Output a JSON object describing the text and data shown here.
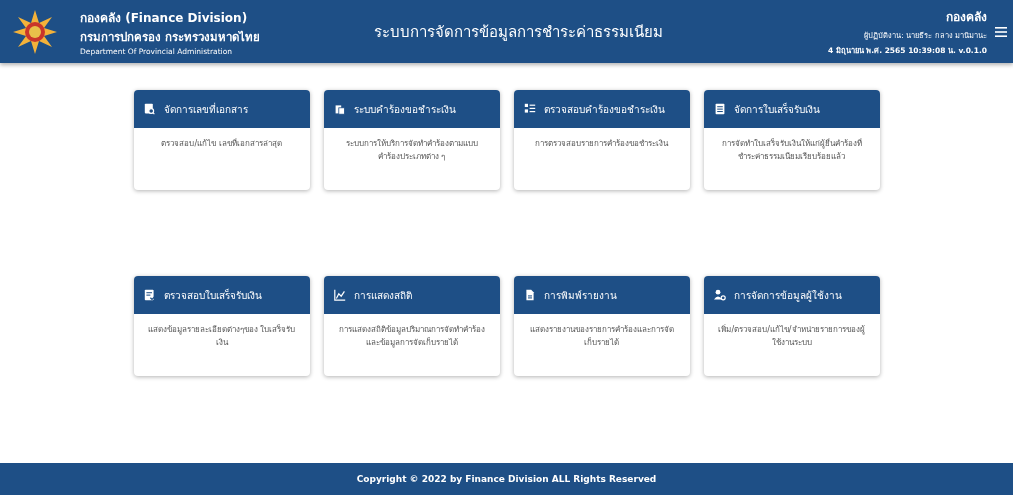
{
  "header": {
    "org_title": "กองคลัง (Finance Division)",
    "org_subtitle": "กรมการปกครอง กระทรวงมหาดไทย",
    "org_english": "Department Of Provincial Administration",
    "system_title": "ระบบการจัดการข้อมูลการชำระค่าธรรมเนียม",
    "unit": "กองคลัง",
    "user": "ผู้ปฏิบัติงาน: นายธีระ กลาง มานิมานะ",
    "datetime": "4 มิถุนายน พ.ศ. 2565 10:39:08 น. v.0.1.0"
  },
  "cards": [
    {
      "title": "จัดการเลขที่เอกสาร",
      "description": "ตรวจสอบ/แก้ไข เลขที่เอกสารล่าสุด"
    },
    {
      "title": "ระบบคำร้องขอชำระเงิน",
      "description": "ระบบการให้บริการจัดทำคำร้องตามแบบคำร้องประเภทต่าง ๆ"
    },
    {
      "title": "ตรวจสอบคำร้องขอชำระเงิน",
      "description": "การตรวจสอบรายการคำร้องขอชำระเงิน"
    },
    {
      "title": "จัดการใบเสร็จรับเงิน",
      "description": "การจัดทำใบเสร็จรับเงินให้แก่ผู้ยื่นคำร้องที่ชำระค่าธรรมเนียมเรียบร้อยแล้ว"
    },
    {
      "title": "ตรวจสอบใบเสร็จรับเงิน",
      "description": "แสดงข้อมูลรายละเอียดต่างๆของ ใบเสร็จรับเงิน"
    },
    {
      "title": "การแสดงสถิติ",
      "description": "การแสดงสถิติข้อมูลปริมาณการจัดทำคำร้องและข้อมูลการจัดเก็บรายได้"
    },
    {
      "title": "การพิมพ์รายงาน",
      "description": "แสดงรายงานของรายการคำร้องและการจัดเก็บรายได้"
    },
    {
      "title": "การจัดการข้อมูลผู้ใช้งาน",
      "description": "เพิ่ม/ตรวจสอบ/แก้ไข/จำหน่ายรายการของผู้ใช้งานระบบ"
    }
  ],
  "footer": "Copyright © 2022 by Finance Division ALL Rights Reserved"
}
